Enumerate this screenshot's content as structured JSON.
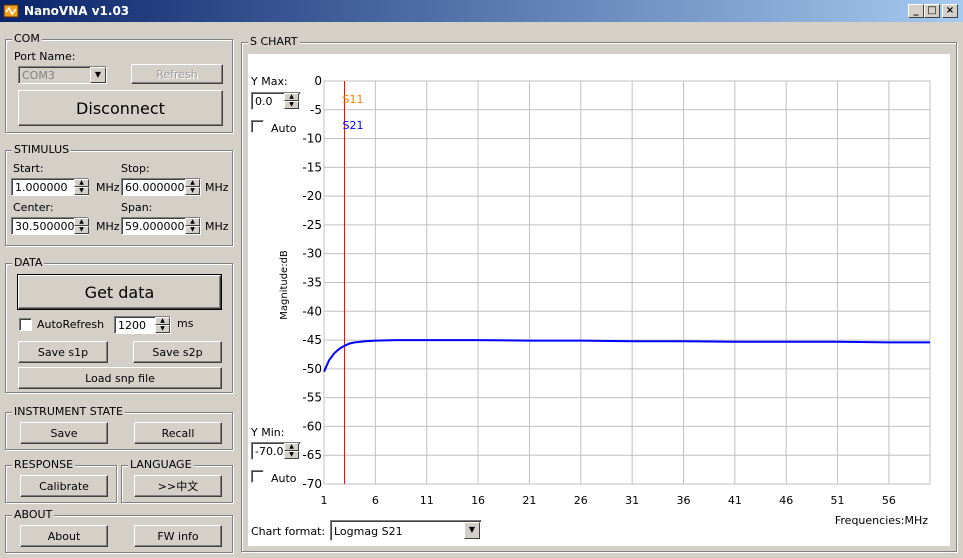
{
  "window": {
    "title": "NanoVNA v1.03"
  },
  "com": {
    "group_label": "COM",
    "port_label": "Port Name:",
    "port_value": "COM3",
    "refresh_label": "Refresh",
    "disconnect_label": "Disconnect"
  },
  "stimulus": {
    "group_label": "STIMULUS",
    "start_label": "Start:",
    "start_value": "1.000000",
    "stop_label": "Stop:",
    "stop_value": "60.000000",
    "center_label": "Center:",
    "center_value": "30.500000",
    "span_label": "Span:",
    "span_value": "59.000000",
    "unit": "MHz"
  },
  "data_group": {
    "group_label": "DATA",
    "get_data_label": "Get data",
    "autorefresh_label": "AutoRefresh",
    "autorefresh_checked": false,
    "interval_value": "1200",
    "interval_unit": "ms",
    "save_s1p_label": "Save s1p",
    "save_s2p_label": "Save s2p",
    "load_snp_label": "Load snp file"
  },
  "instrument_state": {
    "group_label": "INSTRUMENT STATE",
    "save_label": "Save",
    "recall_label": "Recall"
  },
  "response": {
    "group_label": "RESPONSE",
    "calibrate_label": "Calibrate"
  },
  "language": {
    "group_label": "LANGUAGE",
    "button_label": ">>中文"
  },
  "about": {
    "group_label": "ABOUT",
    "about_label": "About",
    "fw_info_label": "FW info"
  },
  "schart": {
    "group_label": "S CHART",
    "ymax_label": "Y Max:",
    "ymax_value": "0.0",
    "ymin_label": "Y Min:",
    "ymin_value": "-70.0",
    "auto_label": "Auto",
    "chart_format_label": "Chart format:",
    "chart_format_value": "Logmag S21"
  },
  "chart_data": {
    "type": "line",
    "ylabel": "Magnitude:dB",
    "xlabel": "Frequencies:MHz",
    "xlim": [
      1,
      60
    ],
    "ylim": [
      -70,
      0
    ],
    "xticks": [
      1,
      6,
      11,
      16,
      21,
      26,
      31,
      36,
      41,
      46,
      51,
      56
    ],
    "yticks": [
      0,
      -5,
      -10,
      -15,
      -20,
      -25,
      -30,
      -35,
      -40,
      -45,
      -50,
      -55,
      -60,
      -65,
      -70
    ],
    "grid": true,
    "marker": {
      "x": 3.0,
      "color": "#ff0000"
    },
    "colors": {
      "s11": "#ff7f00",
      "s21": "#0000ff",
      "grid": "#c0c0c0"
    },
    "series": [
      {
        "name": "S11",
        "x": [],
        "y": []
      },
      {
        "name": "S21",
        "x": [
          1,
          1.5,
          2,
          2.5,
          3,
          3.5,
          4,
          5,
          6,
          8,
          11,
          16,
          21,
          26,
          31,
          36,
          41,
          46,
          51,
          56,
          60
        ],
        "y": [
          -50.5,
          -48.5,
          -47.3,
          -46.5,
          -46.0,
          -45.6,
          -45.4,
          -45.2,
          -45.1,
          -45.0,
          -45.0,
          -45.0,
          -45.1,
          -45.1,
          -45.2,
          -45.2,
          -45.3,
          -45.3,
          -45.3,
          -45.4,
          -45.4
        ]
      }
    ]
  }
}
